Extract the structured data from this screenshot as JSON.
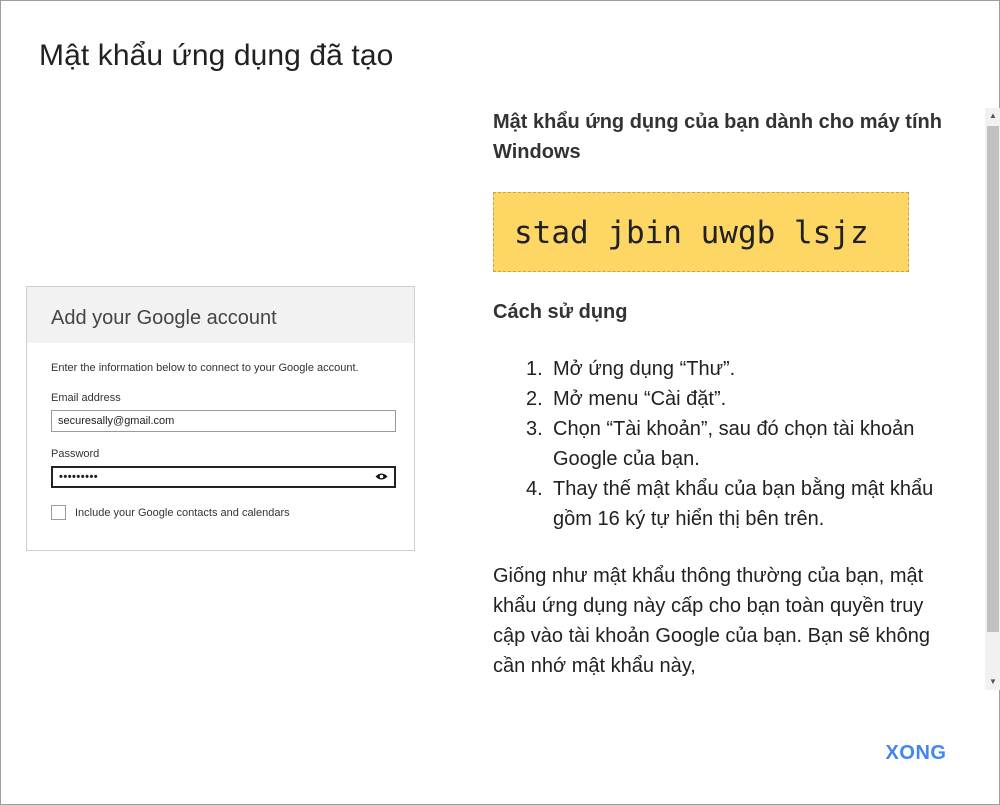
{
  "dialog": {
    "title": "Mật khẩu ứng dụng đã tạo",
    "done_label": "XONG"
  },
  "preview": {
    "header": "Add your Google account",
    "intro": "Enter the information below to connect to your Google account.",
    "email_label": "Email address",
    "email_value": "securesally@gmail.com",
    "password_label": "Password",
    "password_value": "•••••••••",
    "checkbox_label": "Include your Google contacts and calendars",
    "icons": [
      "eye-icon",
      "checkbox-icon"
    ]
  },
  "pane": {
    "heading": "Mật khẩu ứng dụng của bạn dành cho máy tính Windows",
    "app_password": "stad jbin uwgb lsjz",
    "usage_heading": "Cách sử dụng",
    "steps": [
      {
        "num": "1.",
        "text": "Mở ứng dụng “Thư”."
      },
      {
        "num": "2.",
        "text": "Mở menu “Cài đặt”."
      },
      {
        "num": "3.",
        "text": "Chọn “Tài khoản”, sau đó chọn tài khoản Google của bạn."
      },
      {
        "num": "4.",
        "text": "Thay thế mật khẩu của bạn bằng mật khẩu gồm 16 ký tự hiển thị bên trên."
      }
    ],
    "paragraph": "Giống như mật khẩu thông thường của bạn, mật khẩu ứng dụng này cấp cho bạn toàn quyền truy cập vào tài khoản Google của bạn. Bạn sẽ không cần nhớ mật khẩu này,"
  },
  "scrollbar": {
    "up_arrow": "▲",
    "down_arrow": "▼"
  },
  "colors": {
    "password_bg": "#fdd663",
    "accent": "#4285f4",
    "title_text": "#212121"
  }
}
